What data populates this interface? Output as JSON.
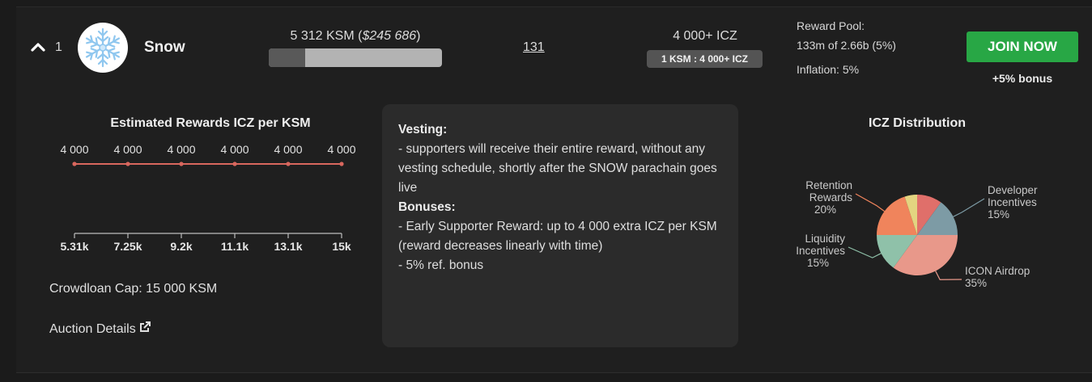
{
  "row": {
    "rank": "1",
    "name": "Snow",
    "raised_ksm": "5 312 KSM",
    "raised_usd": "$245 686",
    "progress_fraction": 0.21,
    "contributors": "131",
    "icz_amount": "4 000+ ICZ",
    "rate": "1 KSM : 4 000+ ICZ",
    "reward_pool_label": "Reward Pool:",
    "reward_pool_value": "133m of 2.66b (5%)",
    "inflation": "Inflation: 5%",
    "join_label": "JOIN NOW",
    "bonus_label": "+5% bonus"
  },
  "icons": {
    "expand": "chevron-up-icon",
    "avatar": "snowflake-icon",
    "external": "external-link-icon"
  },
  "colors": {
    "join_green": "#28a745",
    "line_red": "#d9675e",
    "pie": [
      "#e8988a",
      "#8fc1a9",
      "#f0845c",
      "#e3d480",
      "#e06f6a",
      "#7d9ba5"
    ]
  },
  "left": {
    "cap": "Crowdloan Cap: 15 000 KSM",
    "auction": "Auction Details"
  },
  "info": {
    "vesting_title": "Vesting:",
    "vesting_text": "- supporters will receive their entire reward, without any vesting schedule, shortly after the SNOW parachain goes live",
    "bonuses_title": "Bonuses:",
    "bonus_1": "- Early Supporter Reward: up to 4 000 extra ICZ per KSM (reward decreases linearly with time)",
    "bonus_2": "- 5% ref. bonus"
  },
  "chart_data": [
    {
      "type": "line",
      "title": "Estimated Rewards ICZ per KSM",
      "x": [
        "5.31k",
        "7.25k",
        "9.2k",
        "11.1k",
        "13.1k",
        "15k"
      ],
      "values": [
        4000,
        4000,
        4000,
        4000,
        4000,
        4000
      ],
      "data_labels": [
        "4 000",
        "4 000",
        "4 000",
        "4 000",
        "4 000",
        "4 000"
      ],
      "grid": false
    },
    {
      "type": "pie",
      "title": "ICZ Distribution",
      "slices": [
        {
          "label": "ICON Airdrop",
          "line2": "35%",
          "value": 35
        },
        {
          "label": "Liquidity",
          "line2": "Incentives",
          "line3": "15%",
          "value": 15
        },
        {
          "label": "Retention",
          "line2": "Rewards",
          "line3": "20%",
          "value": 20
        },
        {
          "label": "",
          "value": 5
        },
        {
          "label": "",
          "value": 10
        },
        {
          "label": "Developer",
          "line2": "Incentives",
          "line3": "15%",
          "value": 15
        }
      ]
    }
  ]
}
